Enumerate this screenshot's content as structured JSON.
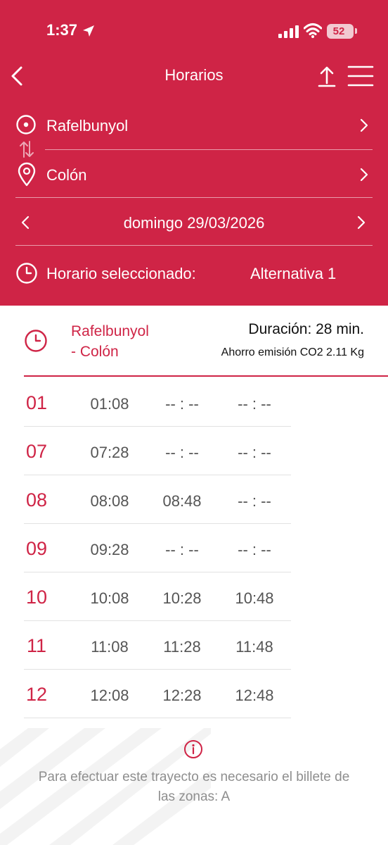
{
  "status": {
    "time": "1:37",
    "battery": "52"
  },
  "header": {
    "title": "Horarios"
  },
  "origin": {
    "label": "Rafelbunyol"
  },
  "destination": {
    "label": "Colón"
  },
  "date": {
    "label": "domingo 29/03/2026"
  },
  "selected": {
    "label": "Horario seleccionado:",
    "value": "Alternativa 1"
  },
  "route": {
    "line1": "Rafelbunyol",
    "line2": "- Colón",
    "duration": "Duración: 28 min.",
    "co2": "Ahorro emisión CO2 2.11 Kg"
  },
  "schedule": [
    {
      "hour": "01",
      "times": [
        "01:08",
        "-- : --",
        "-- : --"
      ]
    },
    {
      "hour": "07",
      "times": [
        "07:28",
        "-- : --",
        "-- : --"
      ]
    },
    {
      "hour": "08",
      "times": [
        "08:08",
        "08:48",
        "-- : --"
      ]
    },
    {
      "hour": "09",
      "times": [
        "09:28",
        "-- : --",
        "-- : --"
      ]
    },
    {
      "hour": "10",
      "times": [
        "10:08",
        "10:28",
        "10:48"
      ]
    },
    {
      "hour": "11",
      "times": [
        "11:08",
        "11:28",
        "11:48"
      ]
    },
    {
      "hour": "12",
      "times": [
        "12:08",
        "12:28",
        "12:48"
      ]
    }
  ],
  "notice": {
    "text": "Para efectuar este trayecto es necesario el billete de las zonas: A"
  },
  "icons": {
    "back": "chevron-left-icon",
    "share": "share-icon",
    "menu": "hamburger-menu-icon",
    "origin": "origin-target-icon",
    "swap": "swap-arrows-icon",
    "destination": "location-pin-icon",
    "clock": "clock-icon",
    "info": "info-icon"
  },
  "colors": {
    "brand": "#cf2446",
    "text_gray": "#555555",
    "notice_gray": "#8e8e8e"
  }
}
